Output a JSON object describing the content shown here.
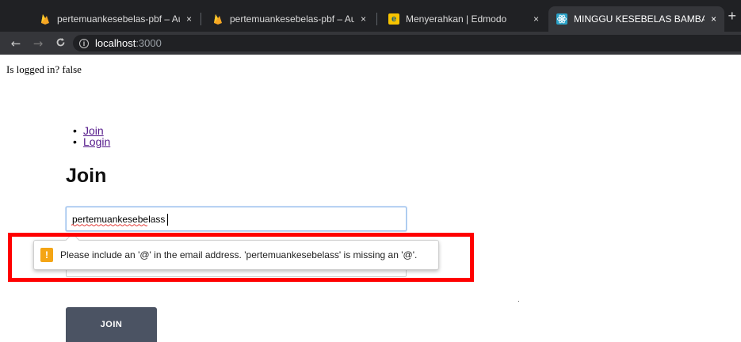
{
  "browser": {
    "tabs": [
      {
        "title": "pertemuankesebelas-pbf – Authe",
        "icon": "firebase-icon",
        "icon_color": "#f6a623",
        "active": false
      },
      {
        "title": "pertemuankesebelas-pbf – Authe",
        "icon": "firebase-icon",
        "icon_color": "#f6a623",
        "active": false
      },
      {
        "title": "Menyerahkan | Edmodo",
        "icon": "edmodo-icon",
        "icon_color": "#f7c400",
        "active": false
      },
      {
        "title": "MINGGU KESEBELAS BAMBANG",
        "icon": "react-icon",
        "icon_color": "#2aa3c9",
        "active": true
      }
    ],
    "close_glyph": "×",
    "new_tab_glyph": "+",
    "url_host": "localhost",
    "url_port": ":3000"
  },
  "page": {
    "status_text": "Is logged in? false",
    "nav_links": [
      "Join",
      "Login"
    ],
    "heading": "Join",
    "email_value": "pertemuankesebelass",
    "validation_message": "Please include an '@' in the email address. 'pertemuankesebelass' is missing an '@'.",
    "warning_glyph": "!",
    "join_button": "JOIN"
  },
  "colors": {
    "highlight": "#ff0000",
    "button_bg": "#4b5363",
    "link": "#551a8b",
    "warning": "#f4a515"
  }
}
